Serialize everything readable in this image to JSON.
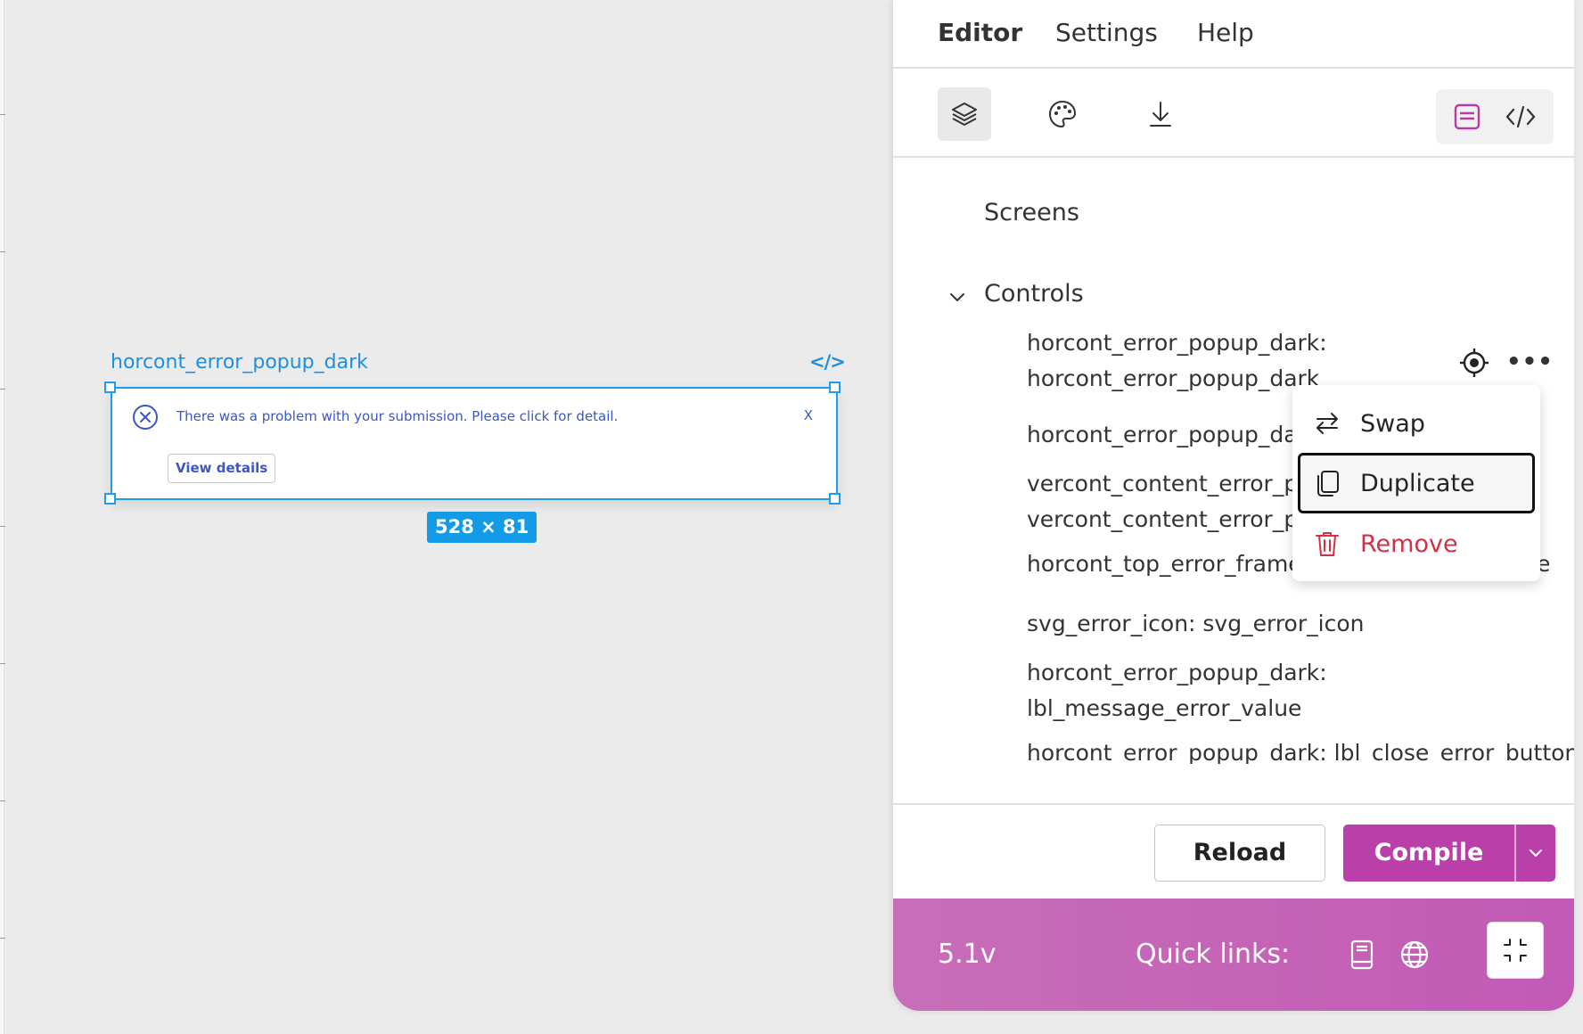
{
  "canvas": {
    "component_name": "horcont_error_popup_dark",
    "code_icon": "code-icon",
    "popup": {
      "message": "There was a problem with your submission. Please click for detail.",
      "close_label": "X",
      "view_details_label": "View details",
      "icon": "error-circle-x-icon"
    },
    "size_badge": "528 × 81"
  },
  "panel": {
    "menu": {
      "editor": "Editor",
      "settings": "Settings",
      "help": "Help"
    },
    "toolbar": {
      "icons": [
        "layers-icon",
        "palette-icon",
        "download-icon",
        "form-view-icon",
        "code-view-icon"
      ]
    },
    "tree": {
      "screens": "Screens",
      "controls": "Controls",
      "rows": [
        {
          "line1": "horcont_error_popup_dark:",
          "line2": "horcont_error_popup_dark"
        },
        {
          "line1": "horcont_error_popup_dark"
        },
        {
          "line1": "vercont_content_error_pop",
          "line2": "vercont_content_error_pop"
        },
        {
          "line1": "horcont_top_error_frame:",
          "tail": "e"
        },
        {
          "line1": "svg_error_icon: svg_error_icon"
        },
        {
          "line1": "horcont_error_popup_dark:",
          "line2": "lbl_message_error_value"
        },
        {
          "line1": "horcont_error_popup_dark: lbl_close_error_button"
        }
      ]
    },
    "context_menu": {
      "swap": "Swap",
      "duplicate": "Duplicate",
      "remove": "Remove"
    },
    "actions": {
      "reload": "Reload",
      "compile": "Compile"
    },
    "status": {
      "version": "5.1v",
      "quick_links": "Quick links:"
    },
    "colors": {
      "accent": "#bb3fa9",
      "selection": "#1f9bf0",
      "danger": "#d23044"
    }
  }
}
